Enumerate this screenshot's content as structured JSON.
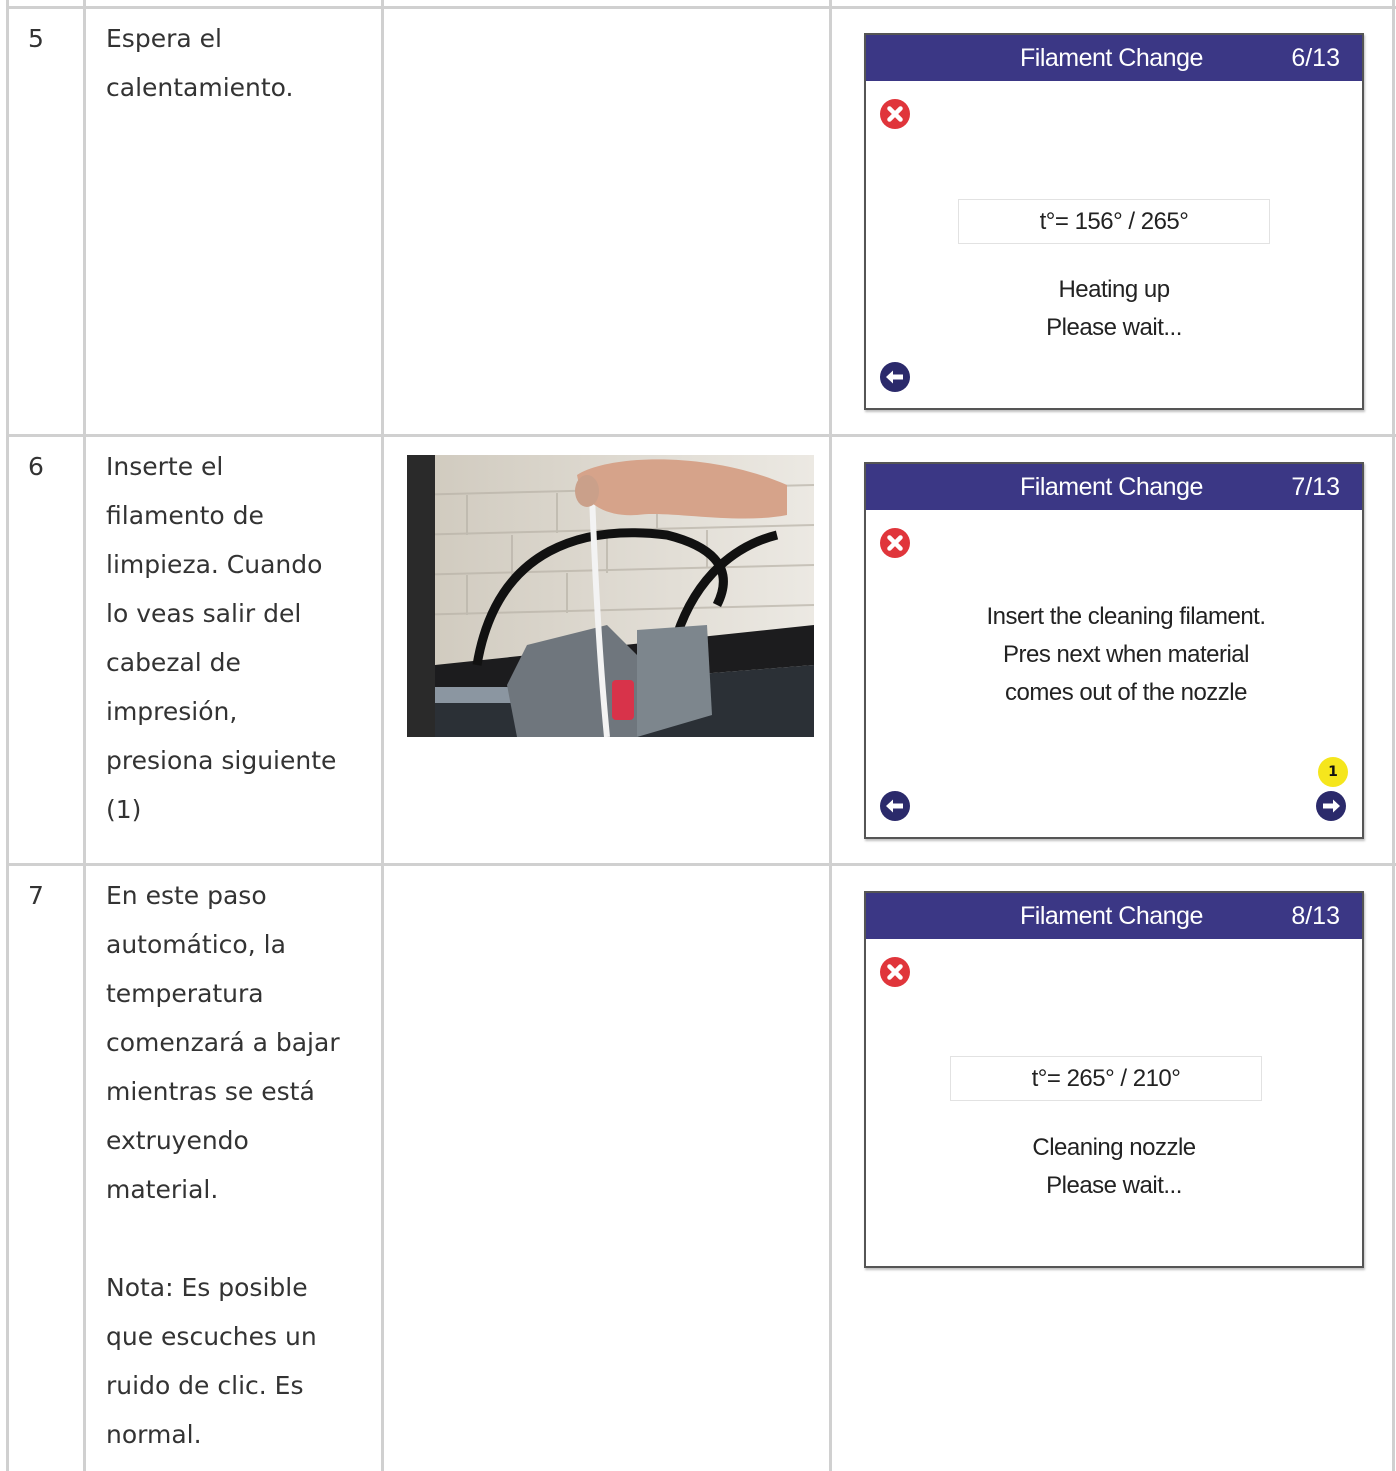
{
  "rows": [
    {
      "number": "5",
      "description": "Espera el\ncalentamiento.",
      "screen": {
        "title": "Filament Change",
        "page": "6/13",
        "temperature": "t°= 156° / 265°",
        "message": "Heating up\nPlease wait..."
      }
    },
    {
      "number": "6",
      "description": "Inserte el\nfilamento de\nlimpieza. Cuando\nlo veas salir del\ncabezal de\nimpresión,\npresiona siguiente\n(1)",
      "screen": {
        "title": "Filament Change",
        "page": "7/13",
        "message": "Insert the cleaning filament.\nPres next when material\ncomes out of the nozzle",
        "badge": "1"
      }
    },
    {
      "number": "7",
      "description": "En este paso\nautomático, la\ntemperatura\ncomenzará a bajar\nmientras se está\nextruyendo\nmaterial.\n\nNota: Es posible\nque escuches un\nruido de clic. Es\nnormal.",
      "screen": {
        "title": "Filament Change",
        "page": "8/13",
        "temperature": "t°= 265° / 210°",
        "message": "Cleaning nozzle\nPlease wait..."
      }
    }
  ],
  "colors": {
    "header": "#3b3785",
    "close_icon": "#e0353b",
    "nav_icon": "#2b2a6b",
    "badge": "#f5e61d"
  },
  "icons": [
    "close-icon",
    "back-arrow-icon",
    "next-arrow-icon"
  ]
}
